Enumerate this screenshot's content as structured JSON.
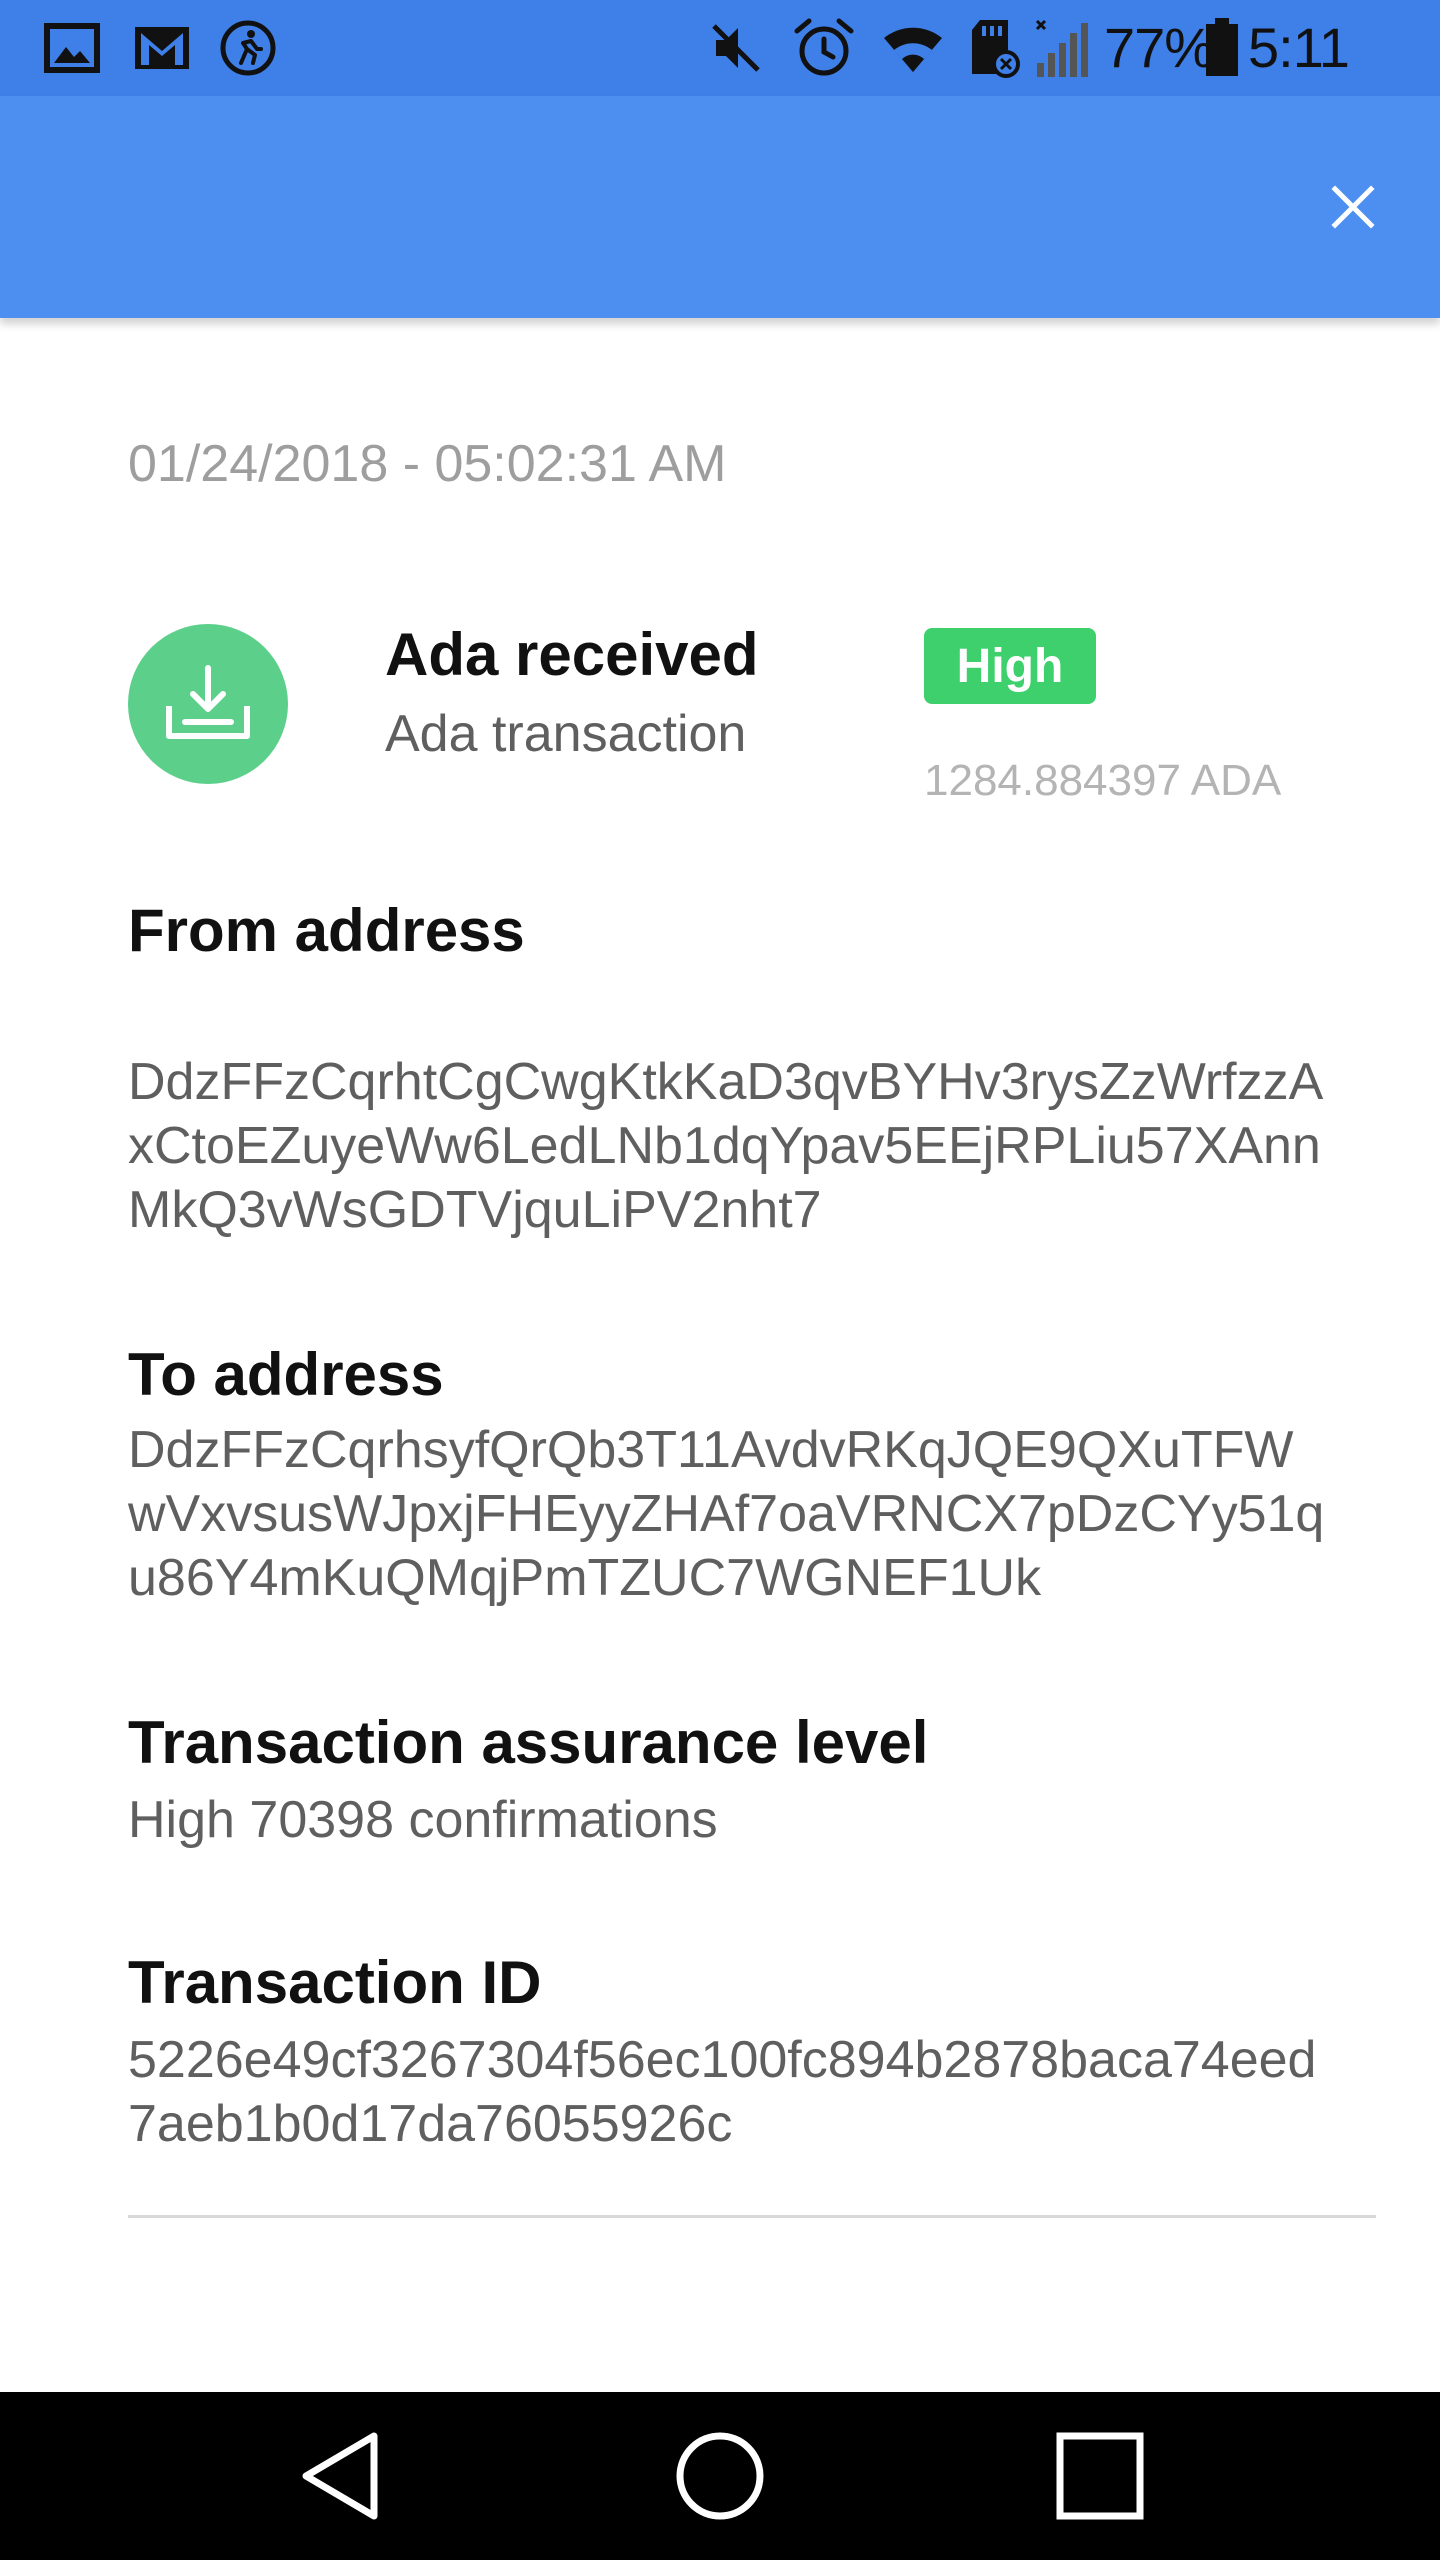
{
  "status_bar": {
    "battery_percent": "77%",
    "time": "5:11 PM",
    "icons": [
      "gallery-icon",
      "gmail-icon",
      "fitness-icon",
      "mute-icon",
      "alarm-icon",
      "wifi-icon",
      "sd-card-icon",
      "signal-icon",
      "battery-icon"
    ]
  },
  "app_bar": {
    "close_icon": "close-icon",
    "accent_color": "#4d8ff0"
  },
  "transaction": {
    "date": "01/24/2018 - 05:02:31 AM",
    "icon": "download-icon",
    "title": "Ada received",
    "subtitle": "Ada transaction",
    "badge": "High",
    "badge_color": "#3dd06c",
    "amount": "1284.884397 ADA"
  },
  "sections": {
    "from": {
      "label": "From address",
      "value": "DdzFFzCqrhtCgCwgKtkKaD3qvBYHv3rysZzWrfzzAxCtoEZuyeWw6LedLNb1dqYpav5EEjRPLiu57XAnnMkQ3vWsGDTVjquLiPV2nht7"
    },
    "to": {
      "label": "To address",
      "value": "DdzFFzCqrhsyfQrQb3T11AvdvRKqJQE9QXuTFWwVxvsusWJpxjFHEyyZHAf7oaVRNCX7pDzCYy51qu86Y4mKuQMqjPmTZUC7WGNEF1Uk"
    },
    "assurance": {
      "label": "Transaction assurance level",
      "value": "High 70398 confirmations"
    },
    "tx_id": {
      "label": "Transaction ID",
      "value": "5226e49cf3267304f56ec100fc894b2878baca74eed7aeb1b0d17da76055926c"
    }
  },
  "nav_bar": {
    "icons": [
      "back-icon",
      "home-icon",
      "recents-icon"
    ]
  }
}
